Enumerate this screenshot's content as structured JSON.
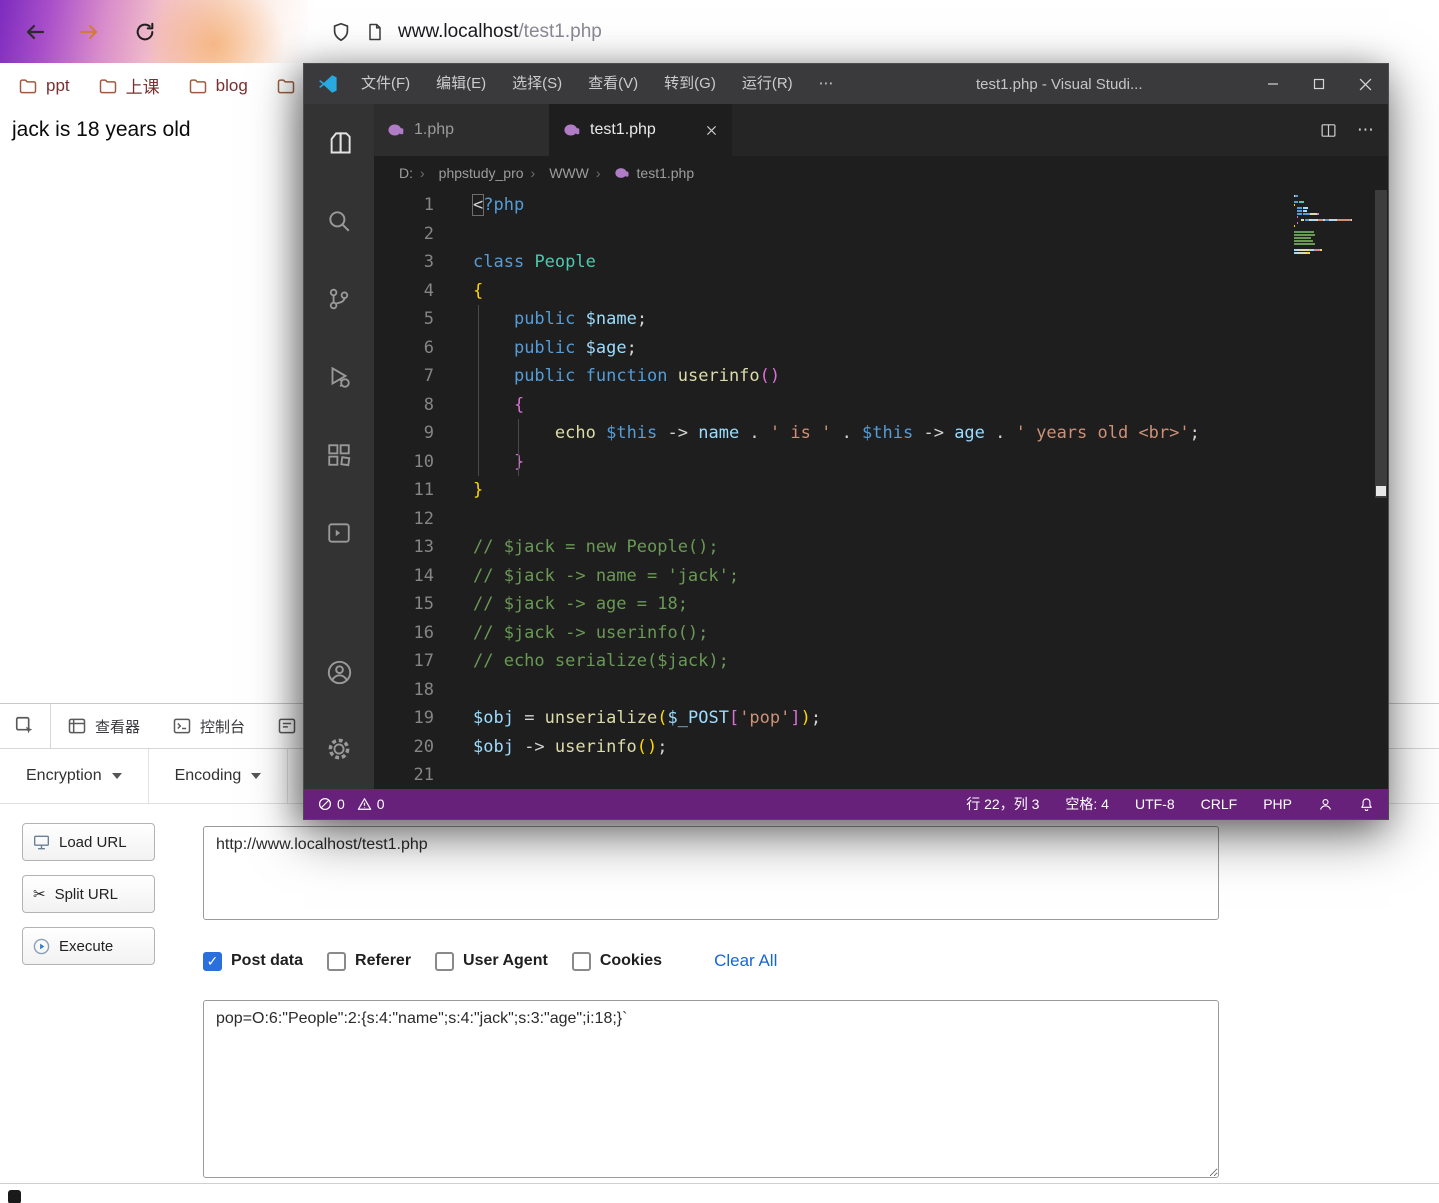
{
  "colors": {
    "status_bar": "#68217a",
    "link_blue": "#1766d9",
    "check_blue": "#2b6fdd",
    "logo_blue": "#29a9e2",
    "elephant_purple": "#b07cc6",
    "bookmark_text": "#7a3030"
  },
  "browser": {
    "nav": {
      "url_host": "www.localhost",
      "url_path": "/test1.php"
    },
    "bookmarks": [
      {
        "label": "ppt"
      },
      {
        "label": "上课"
      },
      {
        "label": "blog"
      },
      {
        "label": ""
      }
    ],
    "page_text": "jack is 18 years old",
    "devtools": {
      "tabs": [
        {
          "label": "查看器"
        },
        {
          "label": "控制台"
        }
      ],
      "hackbar": {
        "menus": [
          {
            "label": "Encryption"
          },
          {
            "label": "Encoding"
          }
        ],
        "actions": [
          {
            "label": "Load URL"
          },
          {
            "label": "Split URL"
          },
          {
            "label": "Execute"
          }
        ],
        "url_value": "http://www.localhost/test1.php",
        "options": [
          {
            "label": "Post data",
            "checked": true
          },
          {
            "label": "Referer",
            "checked": false
          },
          {
            "label": "User Agent",
            "checked": false
          },
          {
            "label": "Cookies",
            "checked": false
          }
        ],
        "clear_all": "Clear All",
        "post_data": "pop=O:6:\"People\":2:{s:4:\"name\";s:4:\"jack\";s:3:\"age\";i:18;}`"
      }
    }
  },
  "vscode": {
    "title": "test1.php - Visual Studi...",
    "more": "⋯",
    "menus": [
      {
        "label": "文件(F)"
      },
      {
        "label": "编辑(E)"
      },
      {
        "label": "选择(S)"
      },
      {
        "label": "查看(V)"
      },
      {
        "label": "转到(G)"
      },
      {
        "label": "运行(R)"
      }
    ],
    "tabs": [
      {
        "label": "1.php"
      },
      {
        "label": "test1.php"
      }
    ],
    "breadcrumb": [
      {
        "label": "D:"
      },
      {
        "label": "phpstudy_pro"
      },
      {
        "label": "WWW"
      },
      {
        "label": "test1.php"
      }
    ],
    "status_left": {
      "errors": "0",
      "warnings": "0"
    },
    "status_right": {
      "cursor": "行 22，列 3",
      "indent": "空格: 4",
      "encoding": "UTF-8",
      "eol": "CRLF",
      "lang": "PHP"
    },
    "code_lines": [
      [
        {
          "t": "<",
          "c": "box"
        },
        {
          "t": "?php",
          "c": "kw"
        }
      ],
      [],
      [
        {
          "t": "class",
          "c": "kw"
        },
        {
          "t": " "
        },
        {
          "t": "People",
          "c": "cls"
        }
      ],
      [
        {
          "t": "{",
          "c": "b1"
        }
      ],
      [
        {
          "t": "    "
        },
        {
          "t": "public",
          "c": "kw"
        },
        {
          "t": " "
        },
        {
          "t": "$name",
          "c": "var"
        },
        {
          "t": ";"
        }
      ],
      [
        {
          "t": "    "
        },
        {
          "t": "public",
          "c": "kw"
        },
        {
          "t": " "
        },
        {
          "t": "$age",
          "c": "var"
        },
        {
          "t": ";"
        }
      ],
      [
        {
          "t": "    "
        },
        {
          "t": "public",
          "c": "kw"
        },
        {
          "t": " "
        },
        {
          "t": "function",
          "c": "kw"
        },
        {
          "t": " "
        },
        {
          "t": "userinfo",
          "c": "fn"
        },
        {
          "t": "(",
          "c": "b2"
        },
        {
          "t": ")",
          "c": "b2"
        }
      ],
      [
        {
          "t": "    "
        },
        {
          "t": "{",
          "c": "b2"
        }
      ],
      [
        {
          "t": "        "
        },
        {
          "t": "echo",
          "c": "fn"
        },
        {
          "t": " "
        },
        {
          "t": "$this",
          "c": "kw"
        },
        {
          "t": " -> "
        },
        {
          "t": "name",
          "c": "var"
        },
        {
          "t": " . "
        },
        {
          "t": "' is '",
          "c": "str"
        },
        {
          "t": " . "
        },
        {
          "t": "$this",
          "c": "kw"
        },
        {
          "t": " -> "
        },
        {
          "t": "age",
          "c": "var"
        },
        {
          "t": " . "
        },
        {
          "t": "' years old <br>'",
          "c": "str"
        },
        {
          "t": ";"
        }
      ],
      [
        {
          "t": "    "
        },
        {
          "t": "}",
          "c": "b2"
        }
      ],
      [
        {
          "t": "}",
          "c": "b1"
        }
      ],
      [],
      [
        {
          "t": "// $jack = new People();",
          "c": "cmt"
        }
      ],
      [
        {
          "t": "// $jack -> name = 'jack';",
          "c": "cmt"
        }
      ],
      [
        {
          "t": "// $jack -> age = 18;",
          "c": "cmt"
        }
      ],
      [
        {
          "t": "// $jack -> userinfo();",
          "c": "cmt"
        }
      ],
      [
        {
          "t": "// echo serialize($jack);",
          "c": "cmt"
        }
      ],
      [],
      [
        {
          "t": "$obj",
          "c": "var"
        },
        {
          "t": " = "
        },
        {
          "t": "unserialize",
          "c": "fn"
        },
        {
          "t": "(",
          "c": "b1"
        },
        {
          "t": "$_POST",
          "c": "var"
        },
        {
          "t": "[",
          "c": "b2"
        },
        {
          "t": "'pop'",
          "c": "str"
        },
        {
          "t": "]",
          "c": "b2"
        },
        {
          "t": ")",
          "c": "b1"
        },
        {
          "t": ";"
        }
      ],
      [
        {
          "t": "$obj",
          "c": "var"
        },
        {
          "t": " -> "
        },
        {
          "t": "userinfo",
          "c": "fn"
        },
        {
          "t": "(",
          "c": "b1"
        },
        {
          "t": ")",
          "c": "b1"
        },
        {
          "t": ";"
        }
      ],
      []
    ]
  }
}
